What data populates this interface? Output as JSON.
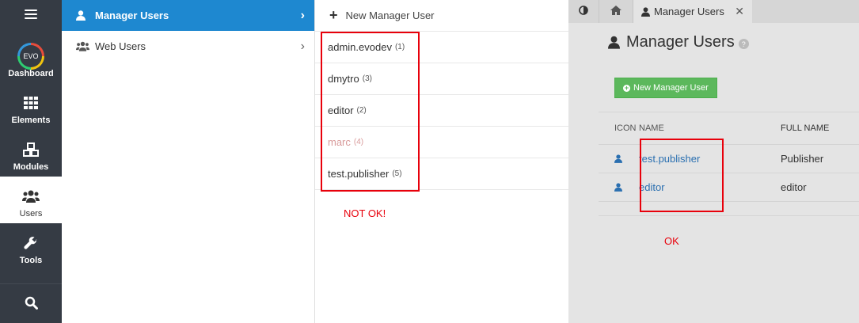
{
  "sidebar": {
    "burger_icon": "bars-icon",
    "items": [
      {
        "label": "Dashboard",
        "icon": "evo-logo",
        "logo_text": "EVO"
      },
      {
        "label": "Elements",
        "icon": "th-icon"
      },
      {
        "label": "Modules",
        "icon": "cubes-icon"
      },
      {
        "label": "Users",
        "icon": "users-icon",
        "active": true
      },
      {
        "label": "Tools",
        "icon": "wrench-icon"
      }
    ],
    "search_icon": "search-icon"
  },
  "submenu": {
    "items": [
      {
        "label": "Manager Users",
        "icon": "user-icon",
        "active": true
      },
      {
        "label": "Web Users",
        "icon": "users-icon"
      }
    ]
  },
  "userlist": {
    "new_label": "New Manager User",
    "rows": [
      {
        "name": "admin.evodev",
        "count": "(1)"
      },
      {
        "name": "dmytro",
        "count": "(3)"
      },
      {
        "name": "editor",
        "count": "(2)"
      },
      {
        "name": "marc",
        "count": "(4)",
        "blocked": true
      },
      {
        "name": "test.publisher",
        "count": "(5)"
      }
    ],
    "annotation": "NOT OK!"
  },
  "pane": {
    "tab_label": "Manager Users",
    "title": "Manager Users",
    "help": "?",
    "new_button": "New Manager User",
    "table": {
      "headers": [
        "ICON",
        "NAME",
        "FULL NAME"
      ],
      "rows": [
        {
          "name": "test.publisher",
          "full_name": "Publisher"
        },
        {
          "name": "editor",
          "full_name": "editor"
        }
      ]
    },
    "annotation": "OK"
  },
  "colors": {
    "sidebar_bg": "#353b44",
    "active_blue": "#1e88d0",
    "button_green": "#5cb85c",
    "annotation_red": "#e8000b",
    "link_blue": "#2a6fb0"
  }
}
